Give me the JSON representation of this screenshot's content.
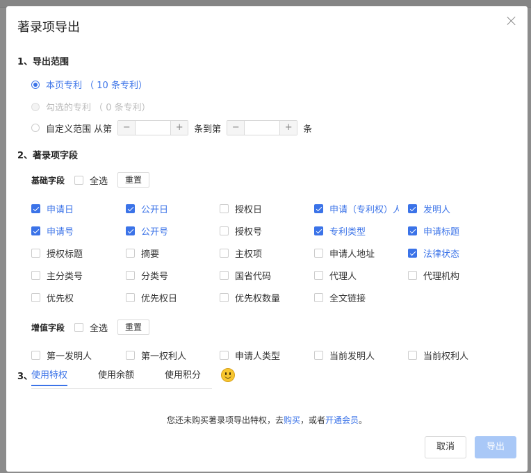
{
  "modal": {
    "title": "著录项导出"
  },
  "range": {
    "section_title": "1、导出范围",
    "options": [
      {
        "label": "本页专利 （ 10 条专利）",
        "state": "selected"
      },
      {
        "label": "勾选的专利 （ 0 条专利）",
        "state": "disabled"
      },
      {
        "label": "自定义范围 从第",
        "state": "unselected"
      }
    ],
    "to_label": "条到第",
    "end_label": "条",
    "from_value": "",
    "to_value": ""
  },
  "fields": {
    "section_title": "2、著录项字段",
    "basic": {
      "label": "基础字段",
      "select_all": "全选",
      "reset": "重置",
      "rows": [
        [
          {
            "label": "申请日",
            "checked": true
          },
          {
            "label": "公开日",
            "checked": true
          },
          {
            "label": "授权日",
            "checked": false
          },
          {
            "label": "申请（专利权）人",
            "checked": true
          },
          {
            "label": "发明人",
            "checked": true
          }
        ],
        [
          {
            "label": "申请号",
            "checked": true
          },
          {
            "label": "公开号",
            "checked": true
          },
          {
            "label": "授权号",
            "checked": false
          },
          {
            "label": "专利类型",
            "checked": true
          },
          {
            "label": "申请标题",
            "checked": true
          }
        ],
        [
          {
            "label": "授权标题",
            "checked": false
          },
          {
            "label": "摘要",
            "checked": false
          },
          {
            "label": "主权项",
            "checked": false
          },
          {
            "label": "申请人地址",
            "checked": false
          },
          {
            "label": "法律状态",
            "checked": true
          }
        ],
        [
          {
            "label": "主分类号",
            "checked": false
          },
          {
            "label": "分类号",
            "checked": false
          },
          {
            "label": "国省代码",
            "checked": false
          },
          {
            "label": "代理人",
            "checked": false
          },
          {
            "label": "代理机构",
            "checked": false
          }
        ],
        [
          {
            "label": "优先权",
            "checked": false
          },
          {
            "label": "优先权日",
            "checked": false
          },
          {
            "label": "优先权数量",
            "checked": false
          },
          {
            "label": "全文链接",
            "checked": false
          }
        ]
      ]
    },
    "value_added": {
      "label": "增值字段",
      "select_all": "全选",
      "reset": "重置",
      "rows": [
        [
          {
            "label": "第一发明人",
            "checked": false
          },
          {
            "label": "第一权利人",
            "checked": false
          },
          {
            "label": "申请人类型",
            "checked": false
          },
          {
            "label": "当前发明人",
            "checked": false
          },
          {
            "label": "当前权利人",
            "checked": false
          }
        ]
      ]
    }
  },
  "privilege": {
    "section_title": "3、",
    "tabs": [
      {
        "label": "使用特权",
        "active": true
      },
      {
        "label": "使用余额",
        "active": false
      },
      {
        "label": "使用积分",
        "active": false
      }
    ],
    "notice_prefix": "您还未购买著录项导出特权，去",
    "notice_link1": "购买",
    "notice_mid": "，或者",
    "notice_link2": "开通会员",
    "notice_suffix": "。"
  },
  "footer": {
    "cancel": "取消",
    "export": "导出"
  },
  "colors": {
    "accent": "#3b73e8",
    "export_disabled": "#a9c8f7"
  }
}
